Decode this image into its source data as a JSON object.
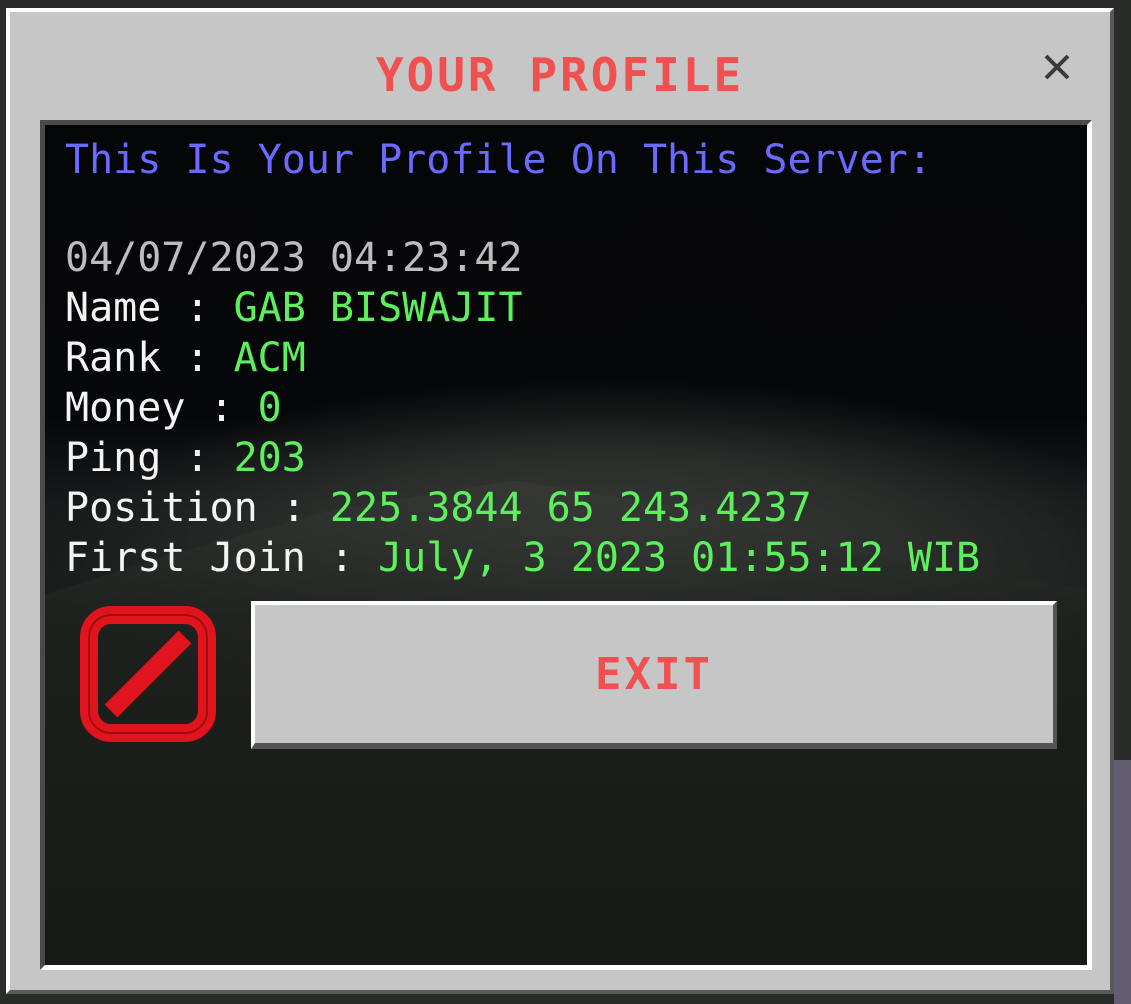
{
  "dialog": {
    "title": "YOUR PROFILE",
    "close_icon": "close-icon"
  },
  "profile": {
    "header": "This Is Your Profile On This Server:",
    "timestamp": "04/07/2023 04:23:42",
    "rows": [
      {
        "label": "Name : ",
        "value": "GAB BISWAJIT"
      },
      {
        "label": "Rank : ",
        "value": "ACM"
      },
      {
        "label": "Money : ",
        "value": "0"
      },
      {
        "label": "Ping : ",
        "value": "203"
      },
      {
        "label": "Position : ",
        "value": "225.3844 65 243.4237"
      },
      {
        "label": "First Join : ",
        "value": "July, 3 2023 01:55:12 WIB"
      }
    ]
  },
  "exit": {
    "label": "EXIT",
    "icon": "no-entry-icon"
  },
  "colors": {
    "title_red": "#f05050",
    "header_blue": "#6a6aff",
    "value_green": "#5cf05c",
    "label_white": "#f4f4f4",
    "timestamp_gray": "#bdbdbd",
    "panel_gray": "#c6c6c6",
    "icon_red": "#e0141c"
  }
}
